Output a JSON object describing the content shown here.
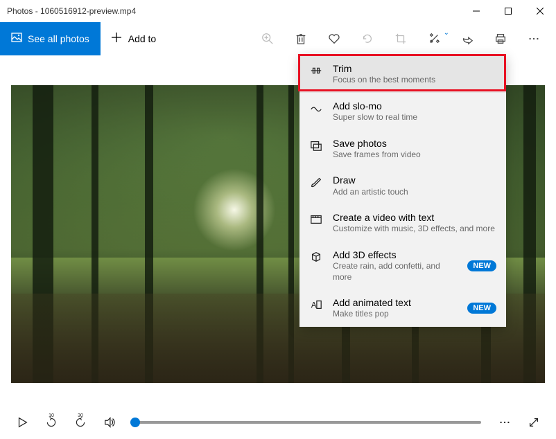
{
  "window": {
    "title": "Photos - 1060516912-preview.mp4"
  },
  "toolbar": {
    "see_all": "See all photos",
    "add_to": "Add to"
  },
  "dropdown": {
    "items": [
      {
        "title": "Trim",
        "sub": "Focus on the best moments"
      },
      {
        "title": "Add slo-mo",
        "sub": "Super slow to real time"
      },
      {
        "title": "Save photos",
        "sub": "Save frames from video"
      },
      {
        "title": "Draw",
        "sub": "Add an artistic touch"
      },
      {
        "title": "Create a video with text",
        "sub": "Customize with music, 3D effects, and more"
      },
      {
        "title": "Add 3D effects",
        "sub": "Create rain, add confetti, and more",
        "badge": "NEW"
      },
      {
        "title": "Add animated text",
        "sub": "Make titles pop",
        "badge": "NEW"
      }
    ]
  },
  "playbar": {
    "skip_back": "10",
    "skip_fwd": "30"
  }
}
